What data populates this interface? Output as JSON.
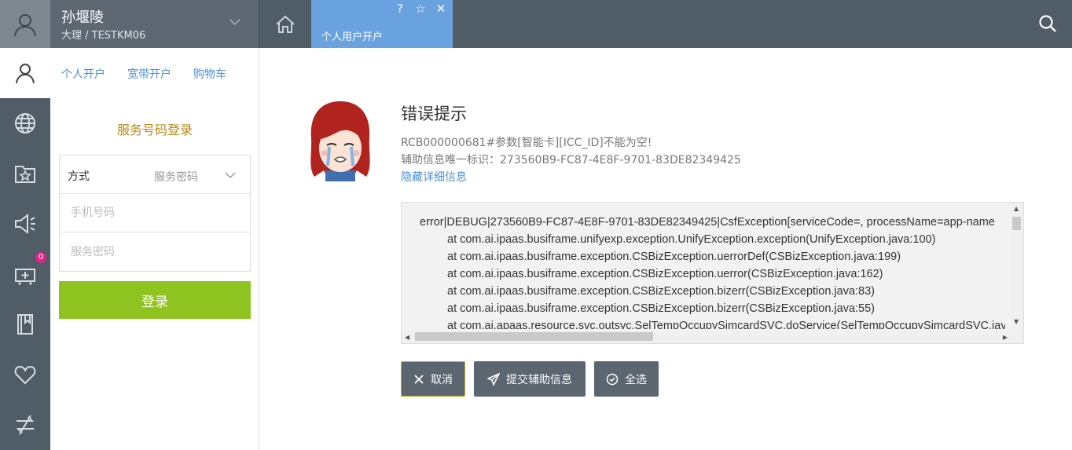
{
  "header": {
    "user_name": "孙堰陵",
    "user_sub": "大理 / TESTKM06",
    "active_tab": "个人用户开户",
    "tab_icons": {
      "help": "?",
      "star": "☆",
      "close": "✕"
    },
    "icons": [
      "user-icon",
      "chevron-down-icon",
      "home-icon",
      "search-icon"
    ]
  },
  "rail": {
    "badge_count": "0",
    "items": [
      "user-icon",
      "globe-icon",
      "folder-star-icon",
      "speaker-icon",
      "cart-plus-icon",
      "book-icon",
      "heart-icon",
      "transfer-icon"
    ]
  },
  "panel": {
    "tabs": [
      "个人开户",
      "宽带开户",
      "购物车"
    ],
    "title": "服务号码登录",
    "method_label": "方式",
    "method_value": "服务密码",
    "phone_placeholder": "手机号码",
    "password_placeholder": "服务密码",
    "login_button": "登录"
  },
  "error": {
    "title": "错误提示",
    "message": "RCB000000681#参数[智能卡][ICC_ID]不能为空!",
    "aux_id": "辅助信息唯一标识：273560B9-FC87-4E8F-9701-83DE82349425",
    "toggle_link": "隐藏详细信息",
    "trace": [
      "error|DEBUG|273560B9-FC87-4E8F-9701-83DE82349425|CsfException[serviceCode=, processName=app-name",
      "at com.ai.ipaas.busiframe.unifyexp.exception.UnifyException.exception(UnifyException.java:100)",
      "at com.ai.ipaas.busiframe.exception.CSBizException.uerrorDef(CSBizException.java:199)",
      "at com.ai.ipaas.busiframe.exception.CSBizException.uerror(CSBizException.java:162)",
      "at com.ai.ipaas.busiframe.exception.CSBizException.bizerr(CSBizException.java:83)",
      "at com.ai.ipaas.busiframe.exception.CSBizException.bizerr(CSBizException.java:55)",
      "at com.ai.apaas.resource.svc.outsvc.SelTempOccupySimcardSVC.doService(SelTempOccupySimcardSVC.java"
    ],
    "buttons": {
      "cancel": "取消",
      "submit": "提交辅助信息",
      "select_all": "全选"
    }
  },
  "colors": {
    "topbar": "#505c66",
    "active_tab": "#6aa2e0",
    "login_button": "#8fc31f",
    "title_gold": "#b88a17",
    "link_blue": "#4a8fd6",
    "badge": "#e0218a"
  }
}
